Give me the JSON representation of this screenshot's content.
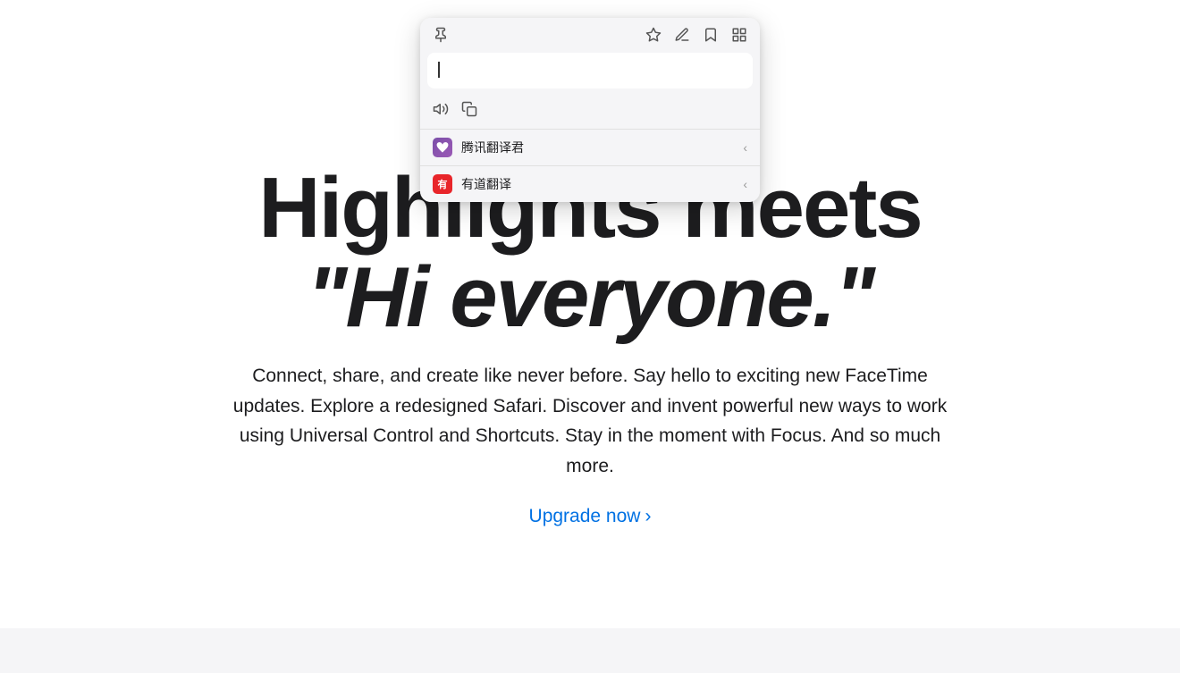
{
  "page": {
    "background_color": "#ffffff"
  },
  "headline": {
    "line1": "Highlights meets",
    "line2": "\"Hi everyone.\""
  },
  "subheadline": {
    "text": "Connect, share, and create like never before. Say hello to exciting new FaceTime updates. Explore a redesigned Safari. Discover and invent powerful new ways to work using Universal Control and Shortcuts. Stay in the moment with Focus. And so much more."
  },
  "upgrade_link": {
    "label": "Upgrade now",
    "chevron": "›"
  },
  "popup": {
    "pin_icon": "📌",
    "header_icons": [
      "★",
      "✏",
      "📖",
      "⊞"
    ],
    "toolbar_icons": [
      "🔊",
      "⧉"
    ],
    "input_placeholder": "",
    "menu_items": [
      {
        "id": "tencent",
        "label": "腾讯翻译君",
        "icon_text": "♥",
        "icon_bg": "#8e4db4"
      },
      {
        "id": "youdao",
        "label": "有道翻译",
        "icon_text": "有",
        "icon_bg": "#e8252a"
      }
    ]
  },
  "bottom_bar": {
    "color": "#f5f5f7"
  }
}
